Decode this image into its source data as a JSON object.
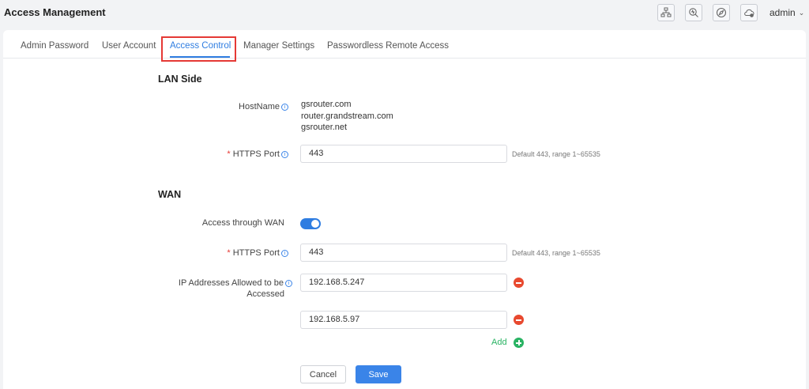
{
  "header": {
    "title": "Access Management",
    "icons": [
      "network-topology-icon",
      "search-diagnose-icon",
      "compass-icon",
      "cloud-icon"
    ],
    "user": "admin"
  },
  "tabs": [
    {
      "label": "Admin Password",
      "active": false
    },
    {
      "label": "User Account",
      "active": false
    },
    {
      "label": "Access Control",
      "active": true
    },
    {
      "label": "Manager Settings",
      "active": false
    },
    {
      "label": "Passwordless Remote Access",
      "active": false
    }
  ],
  "lan": {
    "title": "LAN Side",
    "hostname_label": "HostName",
    "hostnames": [
      "gsrouter.com",
      "router.grandstream.com",
      "gsrouter.net"
    ],
    "https_port_label": "HTTPS Port",
    "https_port_value": "443",
    "https_port_hint": "Default 443, range 1~65535"
  },
  "wan": {
    "title": "WAN",
    "access_label": "Access through WAN",
    "access_enabled": true,
    "https_port_label": "HTTPS Port",
    "https_port_value": "443",
    "https_port_hint": "Default 443, range 1~65535",
    "ip_label_line1": "IP Addresses Allowed to be",
    "ip_label_line2": "Accessed",
    "ip_addresses": [
      "192.168.5.247",
      "192.168.5.97"
    ],
    "add_label": "Add"
  },
  "actions": {
    "cancel": "Cancel",
    "save": "Save"
  },
  "colors": {
    "accent": "#2f7de1",
    "highlight_box": "#e53935",
    "remove": "#e8492f",
    "add": "#29b363"
  }
}
